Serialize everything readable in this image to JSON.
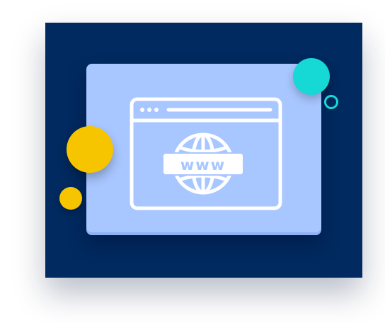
{
  "illustration": {
    "badge_text": "www",
    "colors": {
      "background": "#ffffff",
      "panel": "#002a60",
      "card": "#a8c6ff",
      "line": "#ffffff",
      "yellow": "#f7c500",
      "teal": "#16d8d4"
    },
    "icons": [
      "browser-window-icon",
      "globe-icon"
    ]
  }
}
